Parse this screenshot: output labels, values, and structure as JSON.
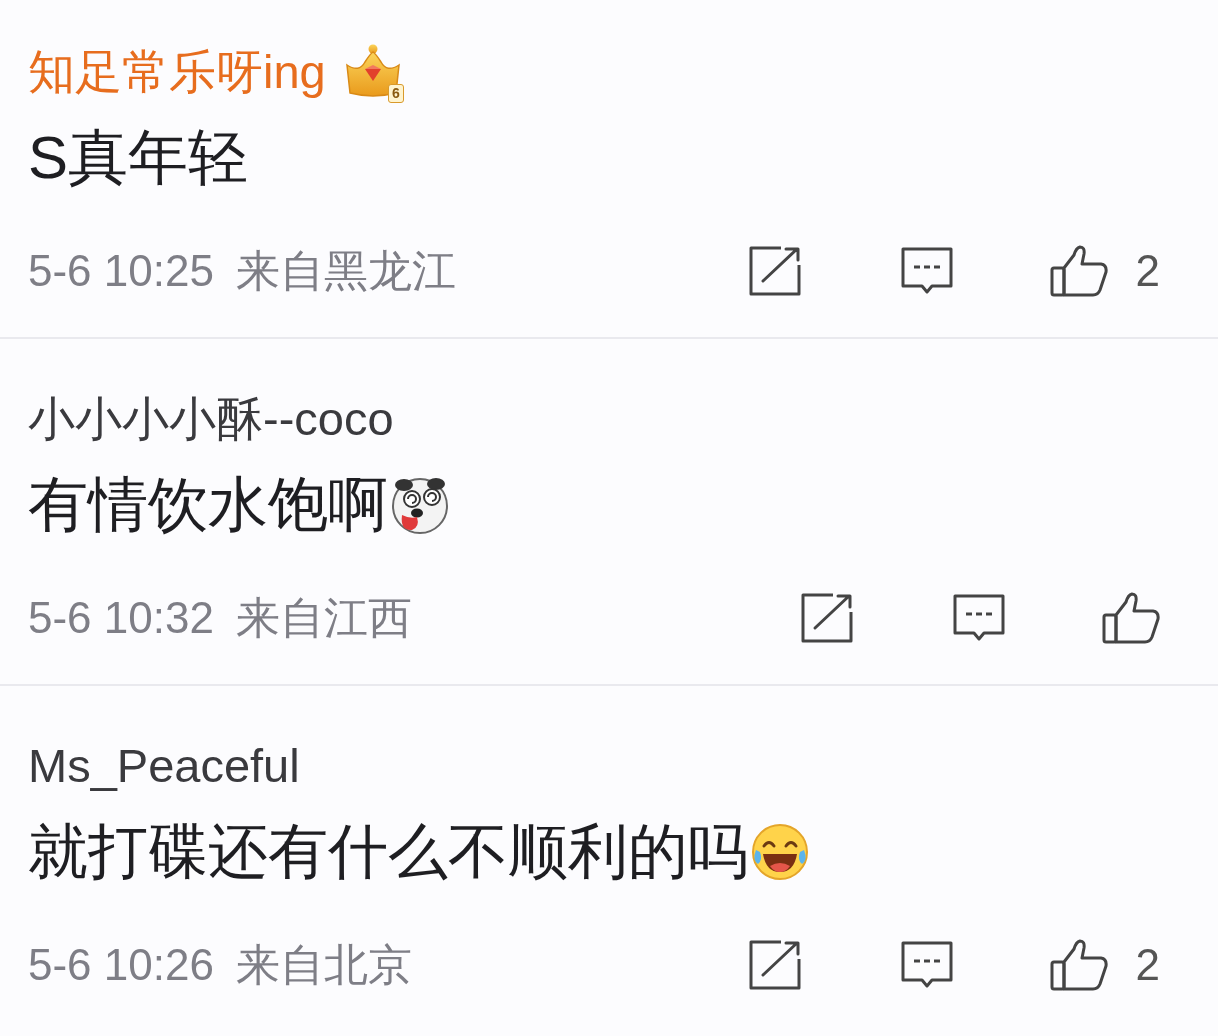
{
  "comments": [
    {
      "username": "知足常乐呀ing",
      "vip": true,
      "vip_level": "6",
      "text": "S真年轻",
      "time": "5-6 10:25",
      "location": "来自黑龙江",
      "likes": "2"
    },
    {
      "username": "小小小小酥--coco",
      "vip": false,
      "text": "有情饮水饱啊",
      "emoji": {
        "kind": "panda"
      },
      "time": "5-6 10:32",
      "location": "来自江西"
    },
    {
      "username": "Ms_Peaceful",
      "vip": false,
      "text": "就打碟还有什么不顺利的吗",
      "emoji": {
        "kind": "laugh"
      },
      "time": "5-6 10:26",
      "location": "来自北京",
      "likes": "2"
    }
  ]
}
